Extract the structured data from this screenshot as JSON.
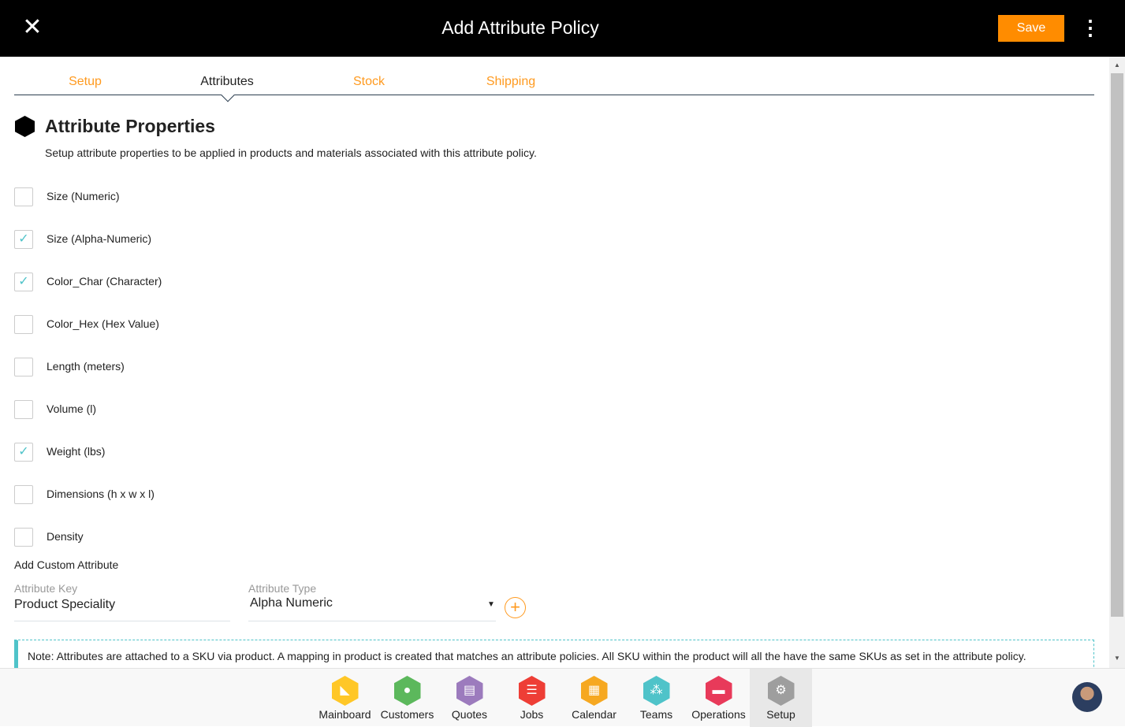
{
  "header": {
    "title": "Add Attribute Policy",
    "save_label": "Save",
    "close_icon": "close-icon",
    "menu_icon": "more-vert-icon"
  },
  "tabs": [
    {
      "label": "Setup"
    },
    {
      "label": "Attributes",
      "active": true
    },
    {
      "label": "Stock"
    },
    {
      "label": "Shipping"
    }
  ],
  "section": {
    "title": "Attribute Properties",
    "description": "Setup attribute properties to be applied in products and materials associated with this attribute policy."
  },
  "attributes": [
    {
      "label": "Size (Numeric)",
      "checked": false
    },
    {
      "label": "Size (Alpha-Numeric)",
      "checked": true
    },
    {
      "label": "Color_Char (Character)",
      "checked": true
    },
    {
      "label": "Color_Hex (Hex Value)",
      "checked": false
    },
    {
      "label": "Length (meters)",
      "checked": false
    },
    {
      "label": "Volume (l)",
      "checked": false
    },
    {
      "label": "Weight (lbs)",
      "checked": true
    },
    {
      "label": "Dimensions (h x w x l)",
      "checked": false
    },
    {
      "label": "Density",
      "checked": false
    }
  ],
  "custom": {
    "heading": "Add Custom Attribute",
    "key_label": "Attribute Key",
    "key_value": "Product Speciality",
    "type_label": "Attribute Type",
    "type_value": "Alpha Numeric"
  },
  "note": "Note: Attributes are attached to a SKU via product. A mapping in product is created that matches an attribute policies. All SKU within the product will all the have the same SKUs as set in the attribute policy.",
  "dock": [
    {
      "label": "Mainboard",
      "color": "#ffc727",
      "icon": "mainboard-icon"
    },
    {
      "label": "Customers",
      "color": "#5cb85c",
      "icon": "customer-icon"
    },
    {
      "label": "Quotes",
      "color": "#9c7bbd",
      "icon": "quotes-icon"
    },
    {
      "label": "Jobs",
      "color": "#ee3e36",
      "icon": "jobs-icon"
    },
    {
      "label": "Calendar",
      "color": "#f6a821",
      "icon": "calendar-icon"
    },
    {
      "label": "Teams",
      "color": "#4fc3c9",
      "icon": "teams-icon"
    },
    {
      "label": "Operations",
      "color": "#e83a5a",
      "icon": "operations-icon"
    },
    {
      "label": "Setup",
      "color": "#9e9e9e",
      "icon": "gear-icon",
      "active": true
    }
  ],
  "colors": {
    "accent": "#ff8c00",
    "teal": "#4fc3c9"
  }
}
